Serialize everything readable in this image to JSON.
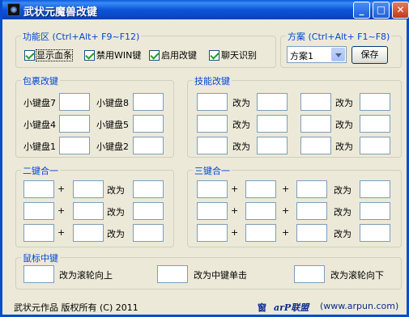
{
  "window": {
    "title": "武状元魔兽改键",
    "min_label": "_",
    "max_label": "□",
    "close_label": "✕"
  },
  "function_area": {
    "legend": "功能区 (Ctrl+Alt+ F9~F12)",
    "checkboxes": [
      {
        "label": "显示血条",
        "checked": true
      },
      {
        "label": "禁用WIN键",
        "checked": true
      },
      {
        "label": "启用改键",
        "checked": true
      },
      {
        "label": "聊天识别",
        "checked": true
      }
    ]
  },
  "scheme": {
    "legend": "方案 (Ctrl+Alt+ F1~F8)",
    "selected": "方案1",
    "save_label": "保存"
  },
  "pack_remap": {
    "legend": "包裹改键",
    "labels": [
      "小键盘7",
      "小键盘8",
      "小键盘4",
      "小键盘5",
      "小键盘1",
      "小键盘2"
    ]
  },
  "skill_remap": {
    "legend": "技能改键",
    "change_to": "改为"
  },
  "combo_left": {
    "legend": "二键合一",
    "plus": "+",
    "change_to": "改为"
  },
  "combo_right": {
    "legend": "三键合一",
    "plus": "+",
    "change_to": "改为"
  },
  "mouse": {
    "legend": "鼠标中键",
    "labels": [
      "改为滚轮向上",
      "改为中键单击",
      "改为滚轮向下"
    ]
  },
  "footer": {
    "left": "武状元作品  版权所有 (C) 2011",
    "link_icon_text": "窗",
    "logo": "arP联盟",
    "url": "(www.arpun.com)"
  },
  "colors": {
    "titlebar": "#0a5bd9",
    "legend": "#0046d5",
    "window_bg": "#ece9d8"
  }
}
